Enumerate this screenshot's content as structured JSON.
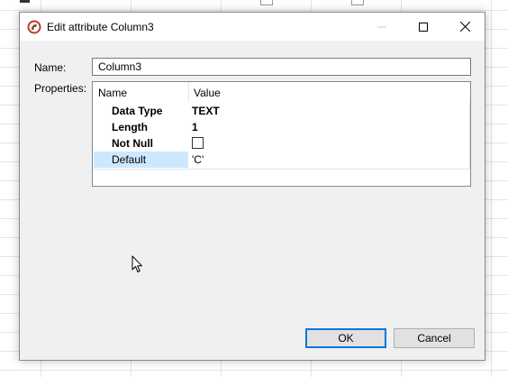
{
  "window": {
    "title": "Edit attribute Column3"
  },
  "form": {
    "name_label": "Name:",
    "name_value": "Column3",
    "properties_label": "Properties:"
  },
  "properties": {
    "columns": [
      "Name",
      "Value"
    ],
    "rows": [
      {
        "name": "Data Type",
        "value": "TEXT"
      },
      {
        "name": "Length",
        "value": "1"
      },
      {
        "name": "Not Null",
        "value": ""
      },
      {
        "name": "Default",
        "value": "'C'"
      }
    ],
    "not_null_checked": false,
    "selected_row": "Default"
  },
  "buttons": {
    "ok": "OK",
    "cancel": "Cancel"
  },
  "colors": {
    "dialog_bg": "#f0f0f0",
    "selection": "#cce8ff",
    "default_button_border": "#0078d7"
  },
  "icons": [
    "app-logo-icon",
    "minimize-icon",
    "maximize-icon",
    "close-icon",
    "mouse-cursor-icon"
  ]
}
